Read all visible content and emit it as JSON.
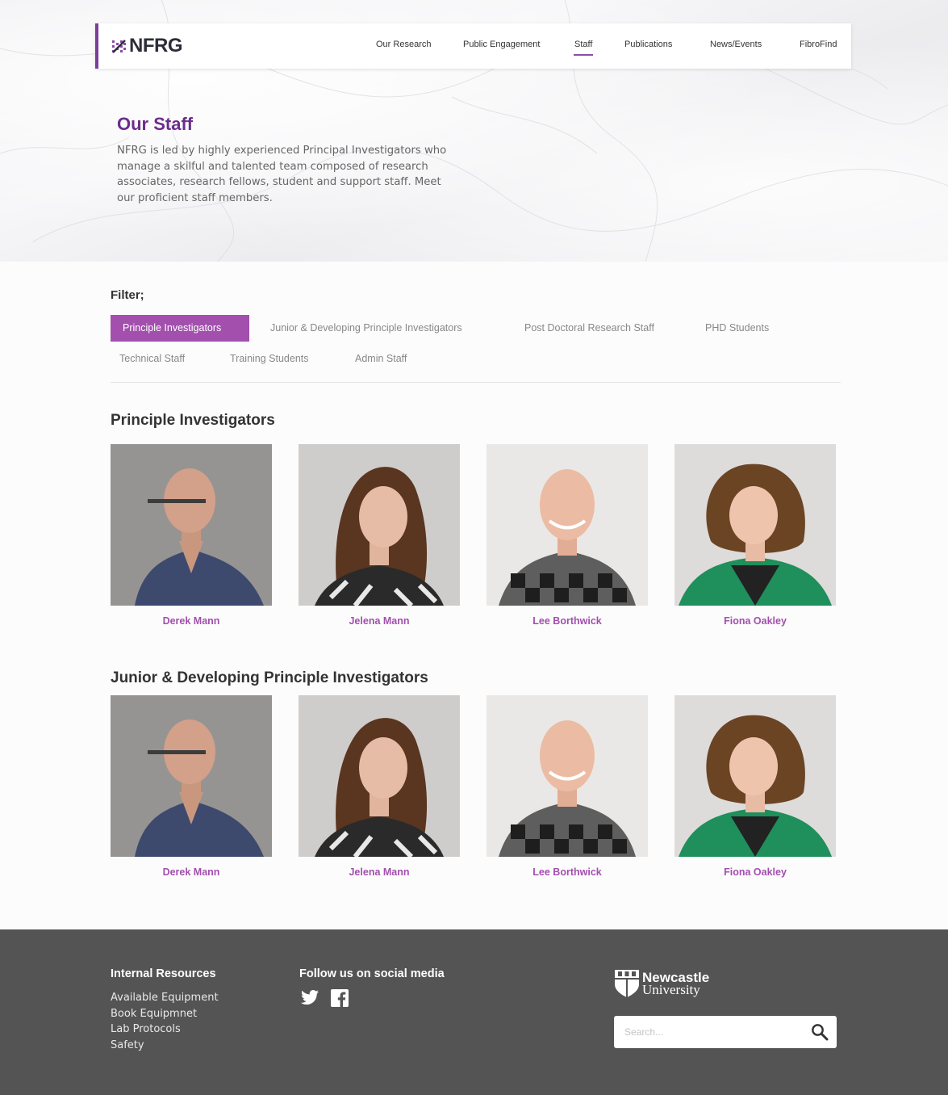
{
  "brand": {
    "name": "NFRG",
    "accent": "#7b3f98",
    "chip_color": "#a24fae"
  },
  "nav": {
    "items": [
      {
        "label": "Our Research"
      },
      {
        "label": "Public Engagement"
      },
      {
        "label": "Staff",
        "active": true
      },
      {
        "label": "Publications"
      },
      {
        "label": "News/Events"
      },
      {
        "label": "FibroFind"
      }
    ]
  },
  "hero": {
    "title": "Our Staff",
    "description": "NFRG is led by highly experienced Principal Investigators who manage a skilful and talented team composed of research associates, research fellows, student and support staff. Meet our proficient staff members."
  },
  "filter": {
    "label": "Filter;",
    "options": [
      {
        "label": "Principle Investigators",
        "active": true
      },
      {
        "label": "Junior & Developing Principle Investigators"
      },
      {
        "label": "Post Doctoral Research Staff"
      },
      {
        "label": "PHD Students"
      },
      {
        "label": "Technical Staff"
      },
      {
        "label": "Training Students"
      },
      {
        "label": "Admin Staff"
      }
    ]
  },
  "sections": [
    {
      "title": "Principle Investigators",
      "people": [
        {
          "name": "Derek Mann",
          "icon": "portrait-photo"
        },
        {
          "name": "Jelena Mann",
          "icon": "portrait-photo"
        },
        {
          "name": "Lee Borthwick",
          "icon": "portrait-photo"
        },
        {
          "name": "Fiona Oakley",
          "icon": "portrait-photo"
        }
      ]
    },
    {
      "title": "Junior & Developing Principle Investigators",
      "people": [
        {
          "name": "Derek Mann",
          "icon": "portrait-photo"
        },
        {
          "name": "Jelena Mann",
          "icon": "portrait-photo"
        },
        {
          "name": "Lee Borthwick",
          "icon": "portrait-photo"
        },
        {
          "name": "Fiona Oakley",
          "icon": "portrait-photo"
        }
      ]
    }
  ],
  "footer": {
    "resources": {
      "title": "Internal Resources",
      "links": [
        "Available Equipment",
        "Book Equipmnet",
        "Lab Protocols",
        "Safety"
      ]
    },
    "social": {
      "title": "Follow us on social media",
      "icons": [
        "twitter-icon",
        "facebook-icon"
      ]
    },
    "university": {
      "line1": "Newcastle",
      "line2": "University"
    },
    "search": {
      "placeholder": "Search...",
      "icon": "search-icon"
    }
  }
}
